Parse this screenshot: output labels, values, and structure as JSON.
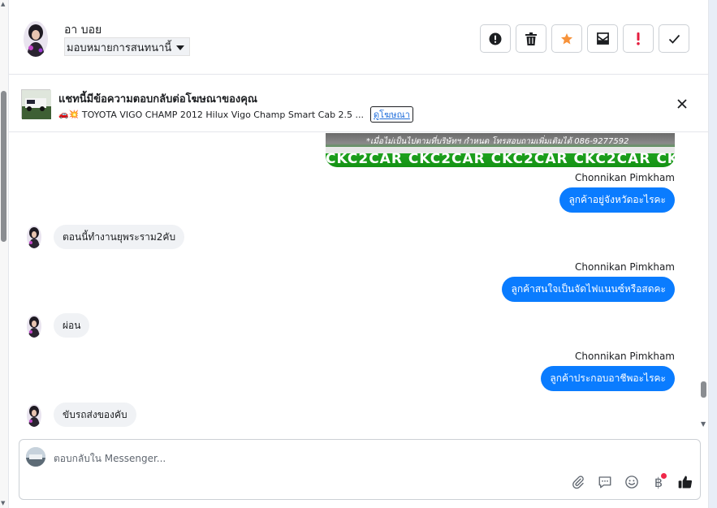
{
  "header": {
    "contact_name": "อา บอย",
    "assign_select": "มอบหมายการสนทนานี้",
    "toolbar": [
      {
        "name": "info-button",
        "icon": "exclamation-circle-icon"
      },
      {
        "name": "delete-button",
        "icon": "trash-icon"
      },
      {
        "name": "star-button",
        "icon": "star-icon",
        "color": "#f7923a"
      },
      {
        "name": "mark-unread-button",
        "icon": "envelope-icon"
      },
      {
        "name": "spam-button",
        "icon": "exclamation-icon",
        "color": "#e41e3f"
      },
      {
        "name": "done-button",
        "icon": "check-icon"
      }
    ]
  },
  "ad_banner": {
    "title": "แชทนี้มีข้อความตอบกลับต่อโฆษณาของคุณ",
    "subtitle": "TOYOTA VIGO CHAMP 2012 Hilux Vigo Champ Smart Cab 2.5 ...",
    "emoji": "🚗💥",
    "link": "ดูโฆษณา"
  },
  "conversation": {
    "image_watermark": "CKC2CAR CKC2CAR CKC2CAR CKC2CAR CKC2",
    "image_caption": "*เมื่อไม่เป็นไปตามที่บริษัทฯ กำหนด โทรสอบถามเพิ่มเติมได้ 086-9277592",
    "messages": [
      {
        "direction": "out",
        "sender": "Chonnikan Pimkham",
        "text": "ลูกค้าอยู่จังหวัดอะไรคะ"
      },
      {
        "direction": "in",
        "text": "ตอนนี้ทำงานยุพระราม2คับ"
      },
      {
        "direction": "out",
        "sender": "Chonnikan Pimkham",
        "text": "ลูกค้าสนใจเป็นจัดไฟแนนซ์หรือสดคะ"
      },
      {
        "direction": "in",
        "text": "ผ่อน"
      },
      {
        "direction": "out",
        "sender": "Chonnikan Pimkham",
        "text": "ลูกค้าประกอบอาชีพอะไรคะ"
      },
      {
        "direction": "in",
        "text": "ขับรถส่งของคับ"
      }
    ]
  },
  "composer": {
    "placeholder": "ตอบกลับใน Messenger...",
    "tools": [
      "paperclip-icon",
      "saved-reply-icon",
      "emoji-icon",
      "baht-payment-icon",
      "thumbs-up-icon"
    ]
  }
}
